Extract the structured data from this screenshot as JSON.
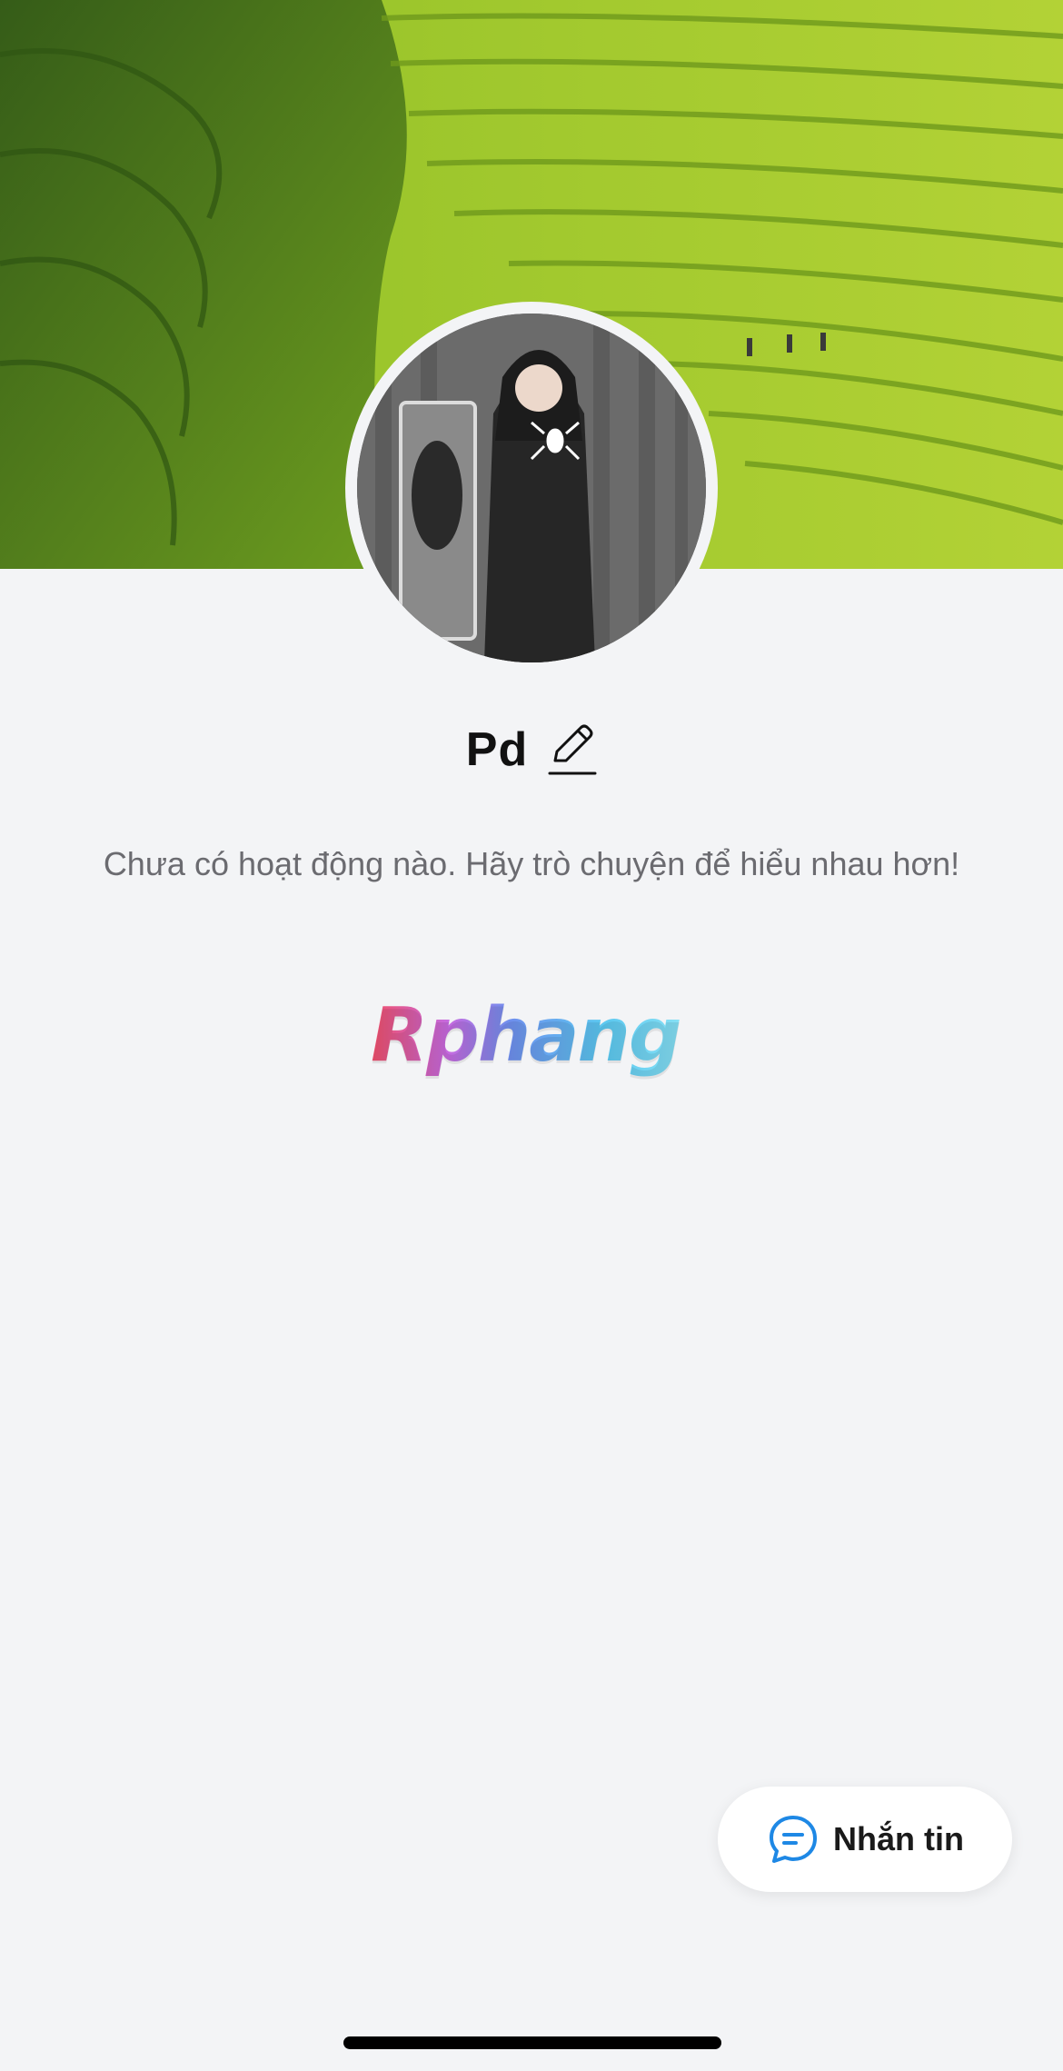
{
  "profile": {
    "name": "Pd",
    "status_text": "Chưa có hoạt động nào. Hãy trò chuyện để hiểu nhau hơn!"
  },
  "logo": {
    "text": "Rphang"
  },
  "actions": {
    "message_label": "Nhắn tin"
  },
  "icons": {
    "edit": "pencil-icon",
    "message": "chat-bubble-icon"
  },
  "colors": {
    "background": "#f3f4f6",
    "accent": "#1e88e5",
    "text": "#111111",
    "muted_text": "#6b6b70"
  }
}
